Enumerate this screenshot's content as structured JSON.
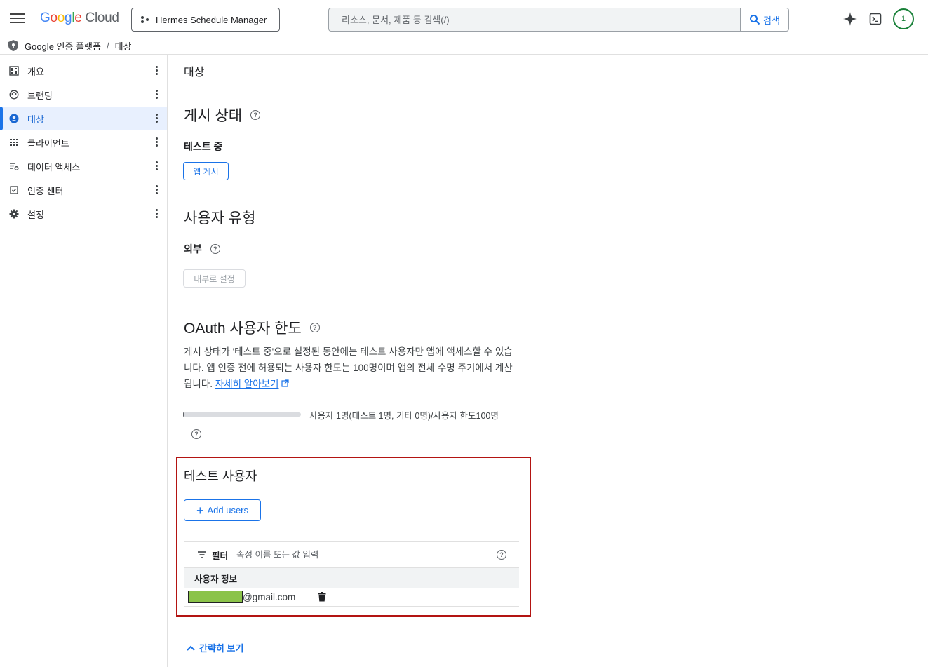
{
  "header": {
    "logo_google": "Google",
    "logo_cloud": "Cloud",
    "project_name": "Hermes Schedule Manager",
    "search_placeholder": "리소스, 문서, 제품 등 검색(/)",
    "search_button": "검색",
    "avatar_text": "1"
  },
  "breadcrumb": {
    "root": "Google 인증 플랫폼",
    "separator": "/",
    "current": "대상"
  },
  "sidebar": {
    "items": [
      {
        "label": "개요",
        "icon": "dashboard-icon"
      },
      {
        "label": "브랜딩",
        "icon": "palette-icon"
      },
      {
        "label": "대상",
        "icon": "person-circle-icon"
      },
      {
        "label": "클라이언트",
        "icon": "grid-icon"
      },
      {
        "label": "데이터 액세스",
        "icon": "data-settings-icon"
      },
      {
        "label": "인증 센터",
        "icon": "verified-icon"
      },
      {
        "label": "설정",
        "icon": "gear-icon"
      }
    ]
  },
  "main": {
    "title": "대상",
    "publish": {
      "heading": "게시 상태",
      "status": "테스트 중",
      "button": "앱 게시"
    },
    "user_type": {
      "heading": "사용자 유형",
      "value": "외부",
      "button": "내부로 설정"
    },
    "oauth": {
      "heading": "OAuth 사용자 한도",
      "description": "게시 상태가 '테스트 중'으로 설정된 동안에는 테스트 사용자만 앱에 액세스할 수 있습니다. 앱 인증 전에 허용되는 사용자 한도는 100명이며 앱의 전체 수명 주기에서 계산됩니다.",
      "learn_more": "자세히 알아보기",
      "progress_fraction": 0.01,
      "progress_text": "사용자 1명(테스트 1명, 기타 0명)/사용자 한도100명"
    },
    "test_users": {
      "heading": "테스트 사용자",
      "add_button": "Add users",
      "filter_label": "필터",
      "filter_placeholder": "속성 이름 또는 값 입력",
      "column_header": "사용자 정보",
      "rows": [
        {
          "email_suffix": "@gmail.com"
        }
      ]
    },
    "collapse_label": "간략히 보기"
  },
  "colors": {
    "accent": "#1a73e8",
    "highlight_border": "#b31412",
    "redaction": "#8bc34a",
    "avatar": "#188038"
  }
}
